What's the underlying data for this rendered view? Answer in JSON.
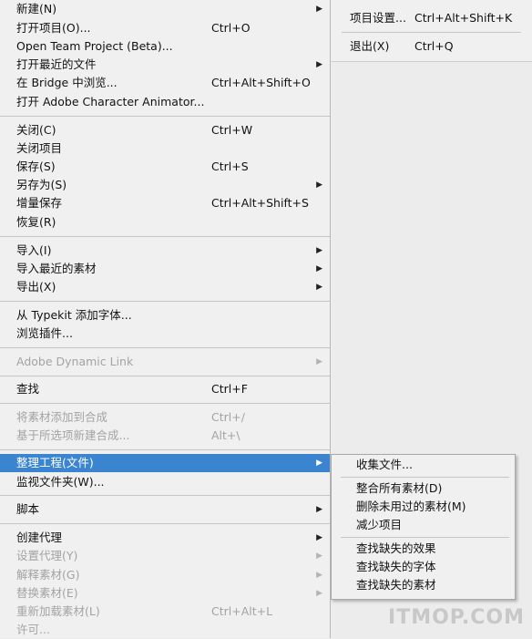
{
  "file_menu": {
    "new": "新建(N)",
    "open_project": "打开项目(O)...",
    "open_project_shortcut": "Ctrl+O",
    "open_team_project": "Open Team Project (Beta)...",
    "open_recent": "打开最近的文件",
    "browse_bridge": "在 Bridge 中浏览...",
    "browse_bridge_shortcut": "Ctrl+Alt+Shift+O",
    "open_character_animator": "打开 Adobe Character Animator...",
    "close": "关闭(C)",
    "close_shortcut": "Ctrl+W",
    "close_project": "关闭项目",
    "save": "保存(S)",
    "save_shortcut": "Ctrl+S",
    "save_as": "另存为(S)",
    "increment_save": "增量保存",
    "increment_save_shortcut": "Ctrl+Alt+Shift+S",
    "revert": "恢复(R)",
    "import": "导入(I)",
    "import_recent": "导入最近的素材",
    "export": "导出(X)",
    "add_typekit_fonts": "从 Typekit 添加字体...",
    "browse_plugins": "浏览插件...",
    "dynamic_link": "Adobe Dynamic Link",
    "find": "查找",
    "find_shortcut": "Ctrl+F",
    "add_footage_to_comp": "将素材添加到合成",
    "add_footage_to_comp_shortcut": "Ctrl+/",
    "new_comp_from_selection": "基于所选项新建合成...",
    "new_comp_from_selection_shortcut": "Alt+\\",
    "dependencies": "整理工程(文件)",
    "watch_folder": "监视文件夹(W)...",
    "scripts": "脚本",
    "create_proxy": "创建代理",
    "set_proxy": "设置代理(Y)",
    "interpret_footage": "解释素材(G)",
    "replace_footage": "替换素材(E)",
    "reload_footage": "重新加载素材(L)",
    "reload_footage_shortcut": "Ctrl+Alt+L",
    "license": "许可..."
  },
  "pref_menu": {
    "project_settings": "项目设置...",
    "project_settings_shortcut": "Ctrl+Alt+Shift+K",
    "exit": "退出(X)",
    "exit_shortcut": "Ctrl+Q"
  },
  "dependencies_submenu": {
    "collect_files": "收集文件...",
    "consolidate_all_footage": "整合所有素材(D)",
    "remove_unused_footage": "删除未用过的素材(M)",
    "reduce_project": "减少项目",
    "find_missing_effects": "查找缺失的效果",
    "find_missing_fonts": "查找缺失的字体",
    "find_missing_footage": "查找缺失的素材"
  },
  "watermark": "ITMOP.COM",
  "colors": {
    "highlight": "#3b85d0",
    "disabled_text": "#a3a3a3",
    "menu_bg": "#f0f0f0"
  }
}
